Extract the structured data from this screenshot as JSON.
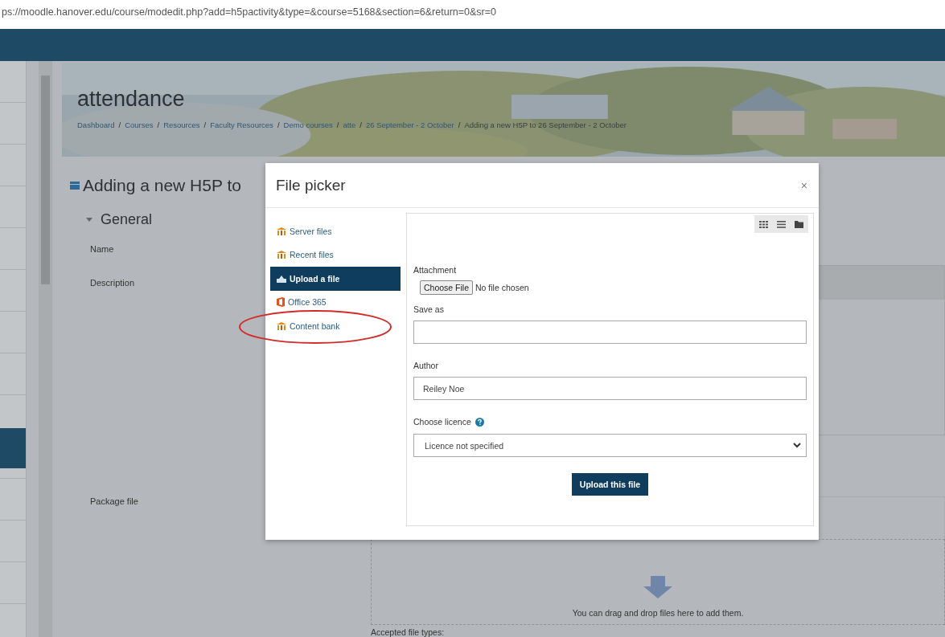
{
  "address_bar": {
    "url": "ps://moodle.hanover.edu/course/modedit.php?add=h5pactivity&type=&course=5168&section=6&return=0&sr=0"
  },
  "page": {
    "title": "attendance",
    "breadcrumbs": [
      "Dashboard",
      "Courses",
      "Resources",
      "Faculty Resources",
      "Demo courses",
      "atte",
      "26 September - 2 October",
      "Adding a new H5P to 26 September - 2 October"
    ],
    "breadcrumb_separator": "/",
    "heading": "Adding a new H5P to",
    "section": {
      "label": "General",
      "expanded": true
    },
    "fields": [
      "Name",
      "Description",
      "Package file"
    ],
    "dropzone": {
      "message": "You can drag and drop files here to add them.",
      "accepted": "Accepted file types:"
    }
  },
  "dialog": {
    "title": "File picker",
    "close": "×",
    "repositories": [
      {
        "label": "Server files",
        "selected": false,
        "kind": "repo"
      },
      {
        "label": "Recent files",
        "selected": false,
        "kind": "repo"
      },
      {
        "label": "Upload a file",
        "selected": true,
        "kind": "upload"
      },
      {
        "label": "Office 365",
        "selected": false,
        "kind": "office"
      },
      {
        "label": "Content bank",
        "selected": false,
        "kind": "repo"
      }
    ],
    "form": {
      "attachment_label": "Attachment",
      "choose_button": "Choose File",
      "no_file": "No file chosen",
      "save_as_label": "Save as",
      "author_label": "Author",
      "author_value": "Reiley Noe",
      "licence_label": "Choose licence",
      "licence_value": "Licence not specified",
      "submit": "Upload this file"
    }
  }
}
